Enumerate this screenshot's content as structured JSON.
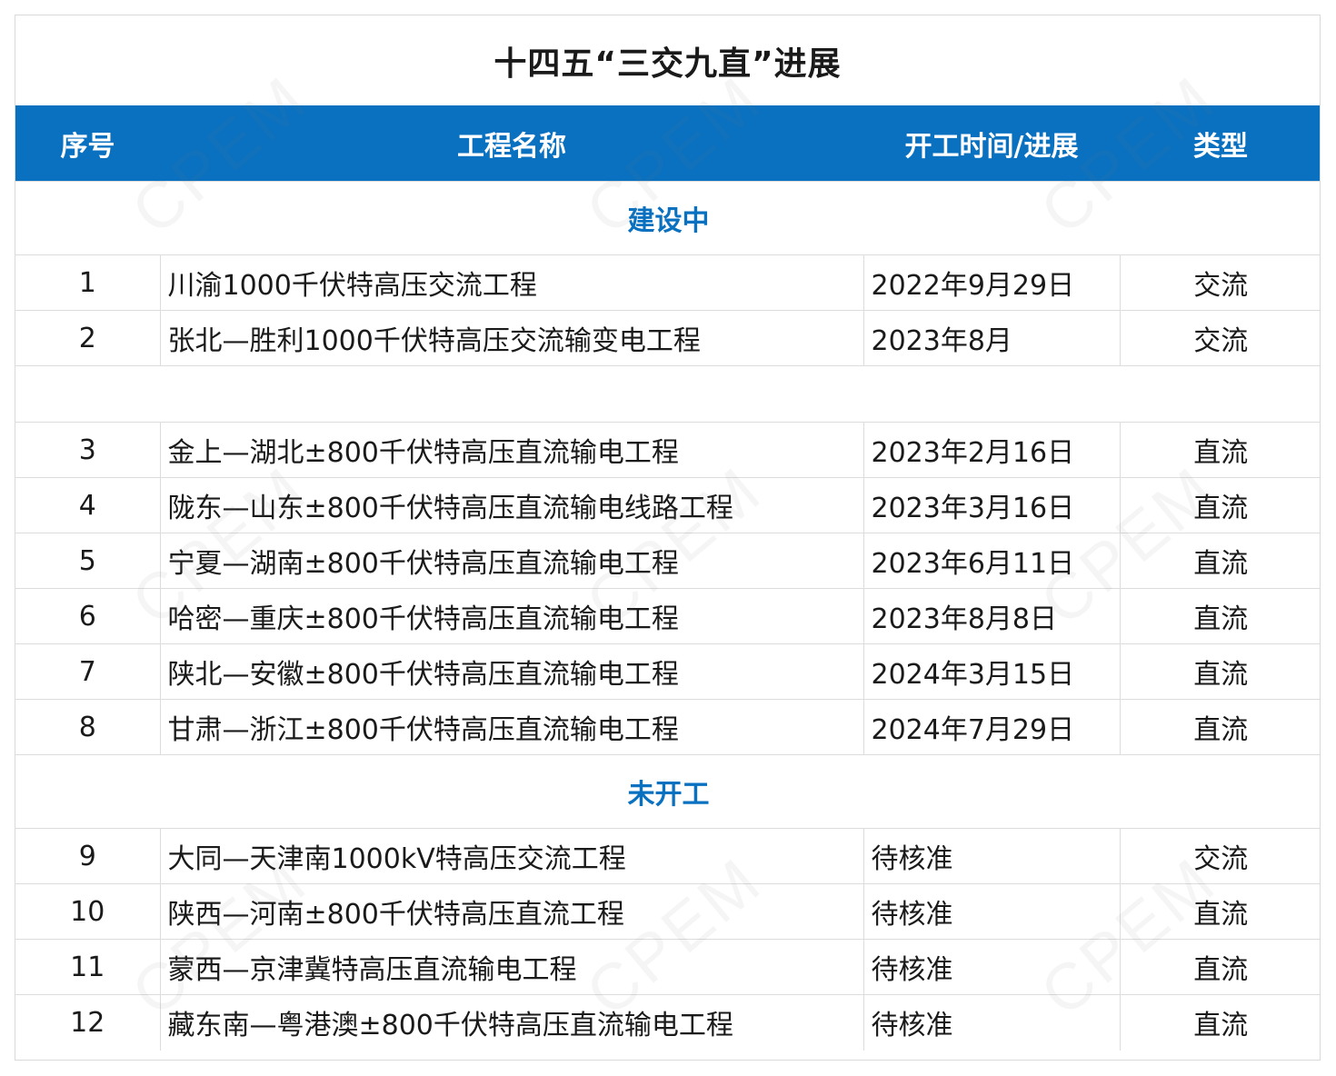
{
  "title": "十四五“三交九直”进展",
  "headers": [
    "序号",
    "工程名称",
    "开工时间/进展",
    "类型"
  ],
  "sections": {
    "building": "建设中",
    "not_started": "未开工"
  },
  "rows": [
    {
      "idx": "1",
      "name": "川渝1000千伏特高压交流工程",
      "date": "2022年9月29日",
      "kind": "交流"
    },
    {
      "idx": "2",
      "name": "张北—胜利1000千伏特高压交流输变电工程",
      "date": "2023年8月",
      "kind": "交流"
    },
    {
      "idx": "3",
      "name": "金上—湖北±800千伏特高压直流输电工程",
      "date": "2023年2月16日",
      "kind": "直流"
    },
    {
      "idx": "4",
      "name": "陇东—山东±800千伏特高压直流输电线路工程",
      "date": "2023年3月16日",
      "kind": "直流"
    },
    {
      "idx": "5",
      "name": "宁夏—湖南±800千伏特高压直流输电工程",
      "date": "2023年6月11日",
      "kind": "直流"
    },
    {
      "idx": "6",
      "name": "哈密—重庆±800千伏特高压直流输电工程",
      "date": "2023年8月8日",
      "kind": "直流"
    },
    {
      "idx": "7",
      "name": "陕北—安徽±800千伏特高压直流输电工程",
      "date": "2024年3月15日",
      "kind": "直流"
    },
    {
      "idx": "8",
      "name": "甘肃—浙江±800千伏特高压直流输电工程",
      "date": "2024年7月29日",
      "kind": "直流"
    },
    {
      "idx": "9",
      "name": "大同—天津南1000kV特高压交流工程",
      "date": "待核准",
      "kind": "交流"
    },
    {
      "idx": "10",
      "name": "陕西—河南±800千伏特高压直流工程",
      "date": "待核准",
      "kind": "直流"
    },
    {
      "idx": "11",
      "name": "蒙西—京津冀特高压直流输电工程",
      "date": "待核准",
      "kind": "直流"
    },
    {
      "idx": "12",
      "name": "藏东南—粤港澳±800千伏特高压直流输电工程",
      "date": "待核准",
      "kind": "直流"
    }
  ],
  "watermark": "CPEM"
}
